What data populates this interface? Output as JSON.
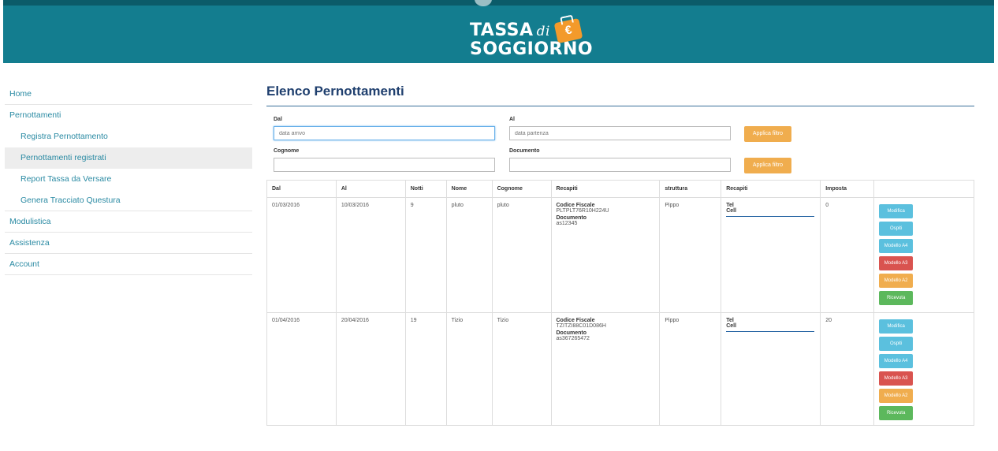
{
  "header": {
    "logo_line1": "TASSA",
    "logo_di": "di",
    "logo_line2": "SOGGIORNO",
    "logo_symbol": "€"
  },
  "sidebar": {
    "items": [
      {
        "label": "Home",
        "level": 0
      },
      {
        "label": "Pernottamenti",
        "level": 0
      },
      {
        "label": "Registra Pernottamento",
        "level": 1
      },
      {
        "label": "Pernottamenti registrati",
        "level": 1,
        "active": true
      },
      {
        "label": "Report Tassa da Versare",
        "level": 1
      },
      {
        "label": "Genera Tracciato Questura",
        "level": 1
      },
      {
        "label": "Modulistica",
        "level": 0
      },
      {
        "label": "Assistenza",
        "level": 0
      },
      {
        "label": "Account",
        "level": 0
      }
    ]
  },
  "main": {
    "title": "Elenco Pernottamenti",
    "filters": {
      "dal_label": "Dal",
      "dal_placeholder": "data arrivo",
      "al_label": "Al",
      "al_placeholder": "data partenza",
      "cognome_label": "Cognome",
      "cognome_value": "",
      "documento_label": "Documento",
      "documento_value": "",
      "apply_label_1": "Applica filtro",
      "apply_label_2": "Applica filtro"
    },
    "table": {
      "headers": [
        "Dal",
        "Al",
        "Notti",
        "Nome",
        "Cognome",
        "Recapiti",
        "struttura",
        "Recapiti",
        "Imposta",
        ""
      ],
      "rows": [
        {
          "dal": "01/03/2016",
          "al": "10/03/2016",
          "notti": "9",
          "nome": "pluto",
          "cognome": "pluto",
          "cf_label": "Codice Fiscale",
          "cf_value": "PLTPLT76R10H224U",
          "doc_label": "Documento",
          "doc_value": "as12345",
          "struttura": "Pippo",
          "tel_label": "Tel",
          "cell_label": "Cell",
          "imposta": "0"
        },
        {
          "dal": "01/04/2016",
          "al": "20/04/2016",
          "notti": "19",
          "nome": "Tizio",
          "cognome": "Tizio",
          "cf_label": "Codice Fiscale",
          "cf_value": "TZITZI88C01D086H",
          "doc_label": "Documento",
          "doc_value": "as367265472",
          "struttura": "Pippo",
          "tel_label": "Tel",
          "cell_label": "Cell",
          "imposta": "20"
        }
      ],
      "actions": {
        "modifica": "Modifica",
        "ospiti": "Ospiti",
        "modello_a4": "Modello A4",
        "modello_a3": "Modello A3",
        "modello_a2": "Modello A2",
        "ricevuta": "Ricevuta"
      }
    }
  },
  "colors": {
    "header_bg": "#137d8f",
    "sidebar_link": "#2a8aa3",
    "title": "#1f3f6e",
    "btn_info": "#5bc0de",
    "btn_danger": "#d9534f",
    "btn_warning": "#f0ad4e",
    "btn_success": "#5cb85c"
  }
}
